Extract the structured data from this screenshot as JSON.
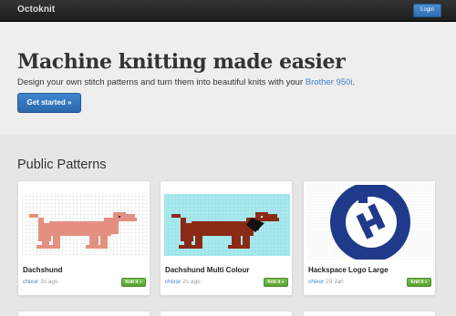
{
  "navbar": {
    "brand": "Octoknit",
    "login_label": "Login"
  },
  "hero": {
    "title": "Machine knitting made easier",
    "subtitle": "Design your own stitch patterns and turn them into beautiful knits with your ",
    "machine_link": "Brother 950i",
    "subtitle_end": ".",
    "cta_label": "Get started »"
  },
  "patterns": {
    "heading": "Public Patterns",
    "cards": [
      {
        "name": "Dachshund",
        "author": "chixor",
        "time": "3s ago",
        "knit_label": "Knit it »"
      },
      {
        "name": "Dachshund Multi Colour",
        "author": "chixor",
        "time": "2s ago",
        "knit_label": "Knit it »"
      },
      {
        "name": "Hackspace Logo Large",
        "author": "chixor",
        "time": "29 Jan",
        "knit_label": "Knit it »"
      }
    ]
  },
  "colors": {
    "dog_pink": "#e49080",
    "dog_brown": "#8b2a14",
    "cyan_bg": "#a9e9ee",
    "logo_blue": "#1f3a8a",
    "accent_blue": "#3f82c5",
    "knit_green": "#5aa332"
  }
}
